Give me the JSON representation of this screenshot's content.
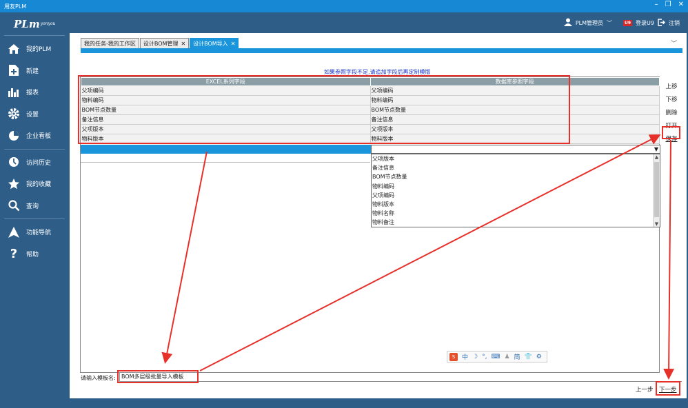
{
  "window": {
    "title": "用友PLM"
  },
  "brand": {
    "logo_text": "PLm",
    "logo_sup": "yonyou"
  },
  "sidebar": {
    "items": [
      {
        "label": "我的PLM",
        "icon": "home-icon"
      },
      {
        "label": "新建",
        "icon": "new-document-icon"
      },
      {
        "label": "报表",
        "icon": "bar-chart-icon"
      },
      {
        "label": "设置",
        "icon": "gear-icon"
      },
      {
        "label": "企业看板",
        "icon": "pie-chart-icon"
      },
      {
        "label": "访问历史",
        "icon": "clock-icon"
      },
      {
        "label": "我的收藏",
        "icon": "star-icon"
      },
      {
        "label": "查询",
        "icon": "search-icon"
      },
      {
        "label": "功能导航",
        "icon": "navigation-arrow-icon"
      },
      {
        "label": "帮助",
        "icon": "help-icon"
      }
    ]
  },
  "header": {
    "user": "PLM管理员",
    "u9_badge": "U9",
    "login_u9": "登录U9",
    "logout": "注销"
  },
  "tabs": [
    {
      "label": "我的任务-我的工作区",
      "closable": false,
      "active": false
    },
    {
      "label": "设计BOM管理",
      "closable": true,
      "active": false
    },
    {
      "label": "设计BOM导入",
      "closable": true,
      "active": true
    }
  ],
  "hint_text": "如果参照字段不足,请追加字段后再定制模版",
  "mapping": {
    "columns": [
      "EXCEL系列字段",
      "数据库参照字段"
    ],
    "rows": [
      [
        "父项编码",
        "父项编码"
      ],
      [
        "物料编码",
        "物料编码"
      ],
      [
        "BOM节点数量",
        "BOM节点数量"
      ],
      [
        "备注信息",
        "备注信息"
      ],
      [
        "父项版本",
        "父项版本"
      ],
      [
        "物料版本",
        "物料版本"
      ]
    ]
  },
  "dropdown_options": [
    "父项版本",
    "备注信息",
    "BOM节点数量",
    "物料编码",
    "父项编码",
    "物料版本",
    "物料名称",
    "物料备注"
  ],
  "side_actions": [
    "上移",
    "下移",
    "删除",
    "打开",
    "保存"
  ],
  "template": {
    "label": "请输入模板名:",
    "value": "BOM多层级批量导入模板"
  },
  "footer": {
    "prev": "上一步",
    "next": "下一步"
  },
  "ime": {
    "items": [
      "中",
      "简"
    ]
  },
  "colors": {
    "accent": "#1a95dc",
    "sidebar": "#2e5e88",
    "annotation": "#e8302a"
  }
}
